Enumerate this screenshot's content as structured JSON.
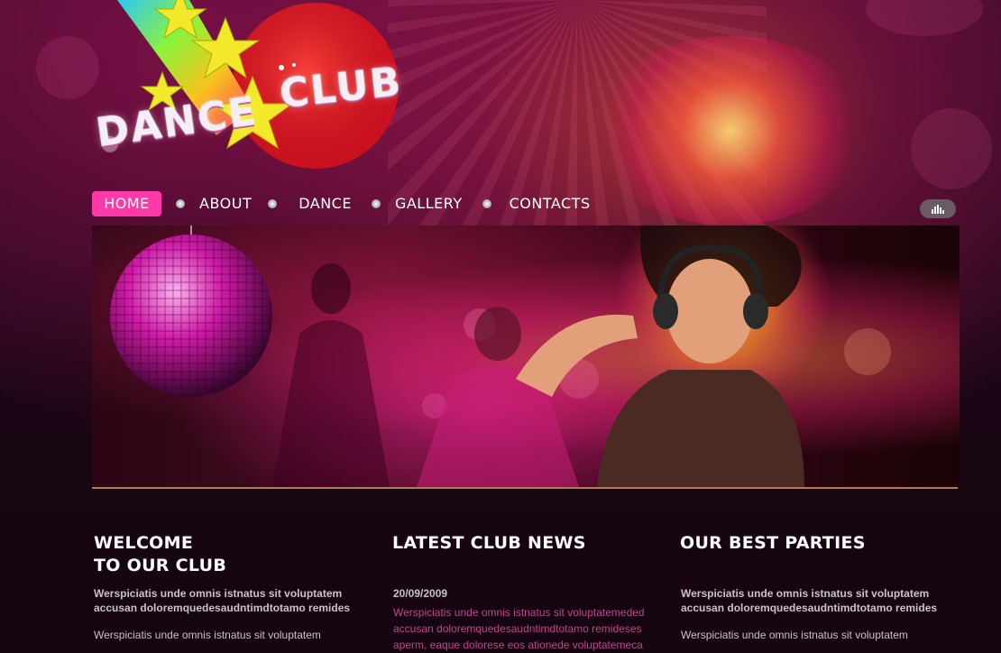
{
  "logo": {
    "word1": "DANCE",
    "word2": "CLUB"
  },
  "nav": {
    "items": [
      "HOME",
      "ABOUT",
      "DANCE",
      "GALLERY",
      "CONTACTS"
    ],
    "active": "HOME"
  },
  "sections": {
    "welcome": {
      "title_line1": "WELCOME",
      "title_line2": "TO OUR CLUB",
      "intro": "Werspiciatis unde omnis istnatus sit voluptatem accusan doloremquedesaudntimdtotamo remides",
      "body": "Werspiciatis unde omnis istnatus sit voluptatem"
    },
    "news": {
      "title": "LATEST CLUB NEWS",
      "date": "20/09/2009",
      "text": "Werspiciatis unde omnis istnatus sit voluptatemeded accusan doloremquedesaudntimdtotamo remideses aperm, eaque dolorese eos ationede voluptatemeca"
    },
    "parties": {
      "title": "OUR BEST PARTIES",
      "intro": "Werspiciatis unde omnis istnatus sit voluptatem accusan doloremquedesaudntimdtotamo remides",
      "body": "Werspiciatis unde omnis istnatus sit voluptatem"
    }
  },
  "colors": {
    "accent": "#ff3aa8",
    "link": "#c2448e",
    "rule": "#b87a48"
  }
}
